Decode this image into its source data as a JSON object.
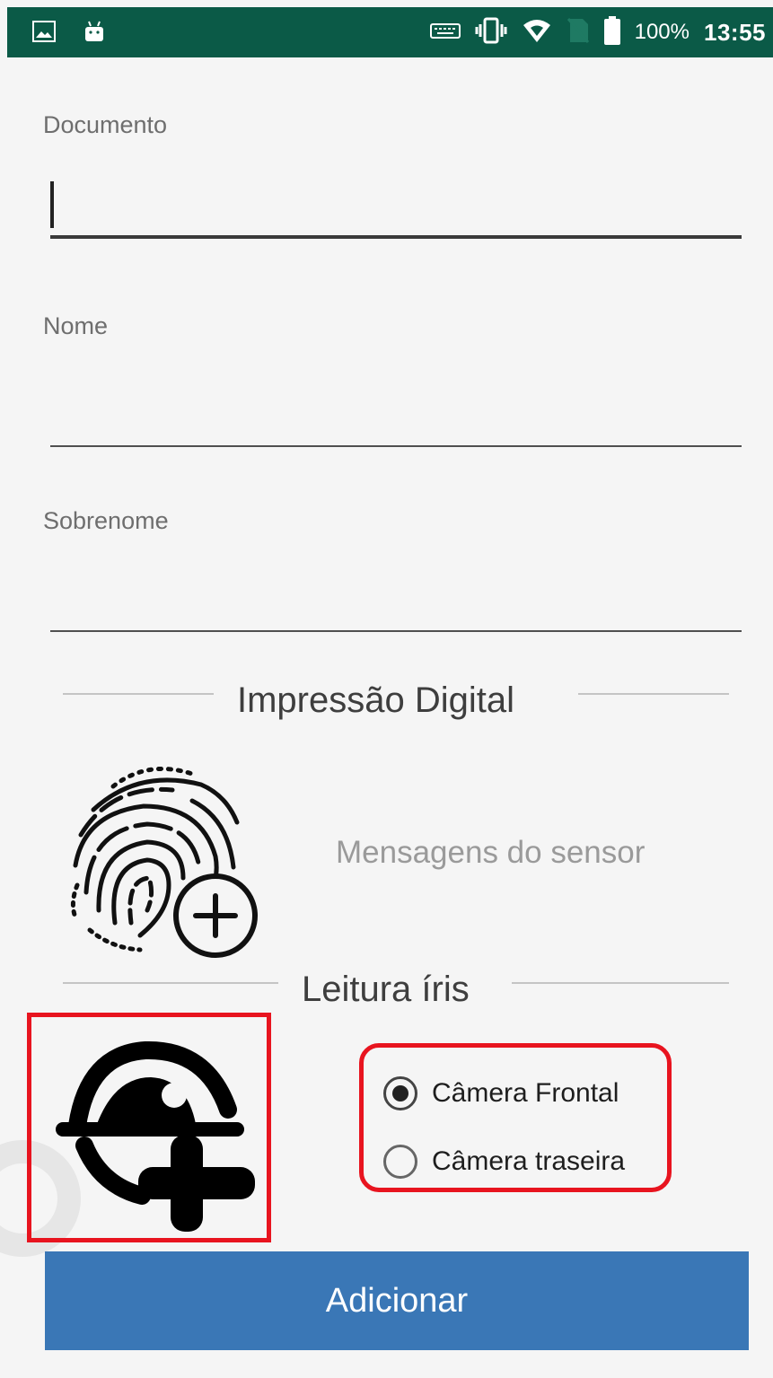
{
  "status_bar": {
    "battery_percent": "100%",
    "time": "13:55",
    "icons": [
      "image-icon",
      "android-icon",
      "keyboard-icon",
      "vibrate-icon",
      "wifi-icon",
      "no-sim-icon",
      "battery-icon"
    ]
  },
  "form": {
    "documento": {
      "label": "Documento",
      "value": ""
    },
    "nome": {
      "label": "Nome",
      "value": ""
    },
    "sobrenome": {
      "label": "Sobrenome",
      "value": ""
    }
  },
  "fingerprint": {
    "section_title": "Impressão Digital",
    "icon": "fingerprint-add-icon",
    "sensor_message": "Mensagens do sensor"
  },
  "iris": {
    "section_title": "Leitura íris",
    "icon": "iris-add-icon",
    "options": [
      {
        "label": "Câmera Frontal",
        "selected": true
      },
      {
        "label": "Câmera traseira",
        "selected": false
      }
    ]
  },
  "actions": {
    "add_label": "Adicionar"
  },
  "colors": {
    "status_bar": "#0b5a47",
    "button": "#3a77b6",
    "highlight": "#e8141f"
  }
}
